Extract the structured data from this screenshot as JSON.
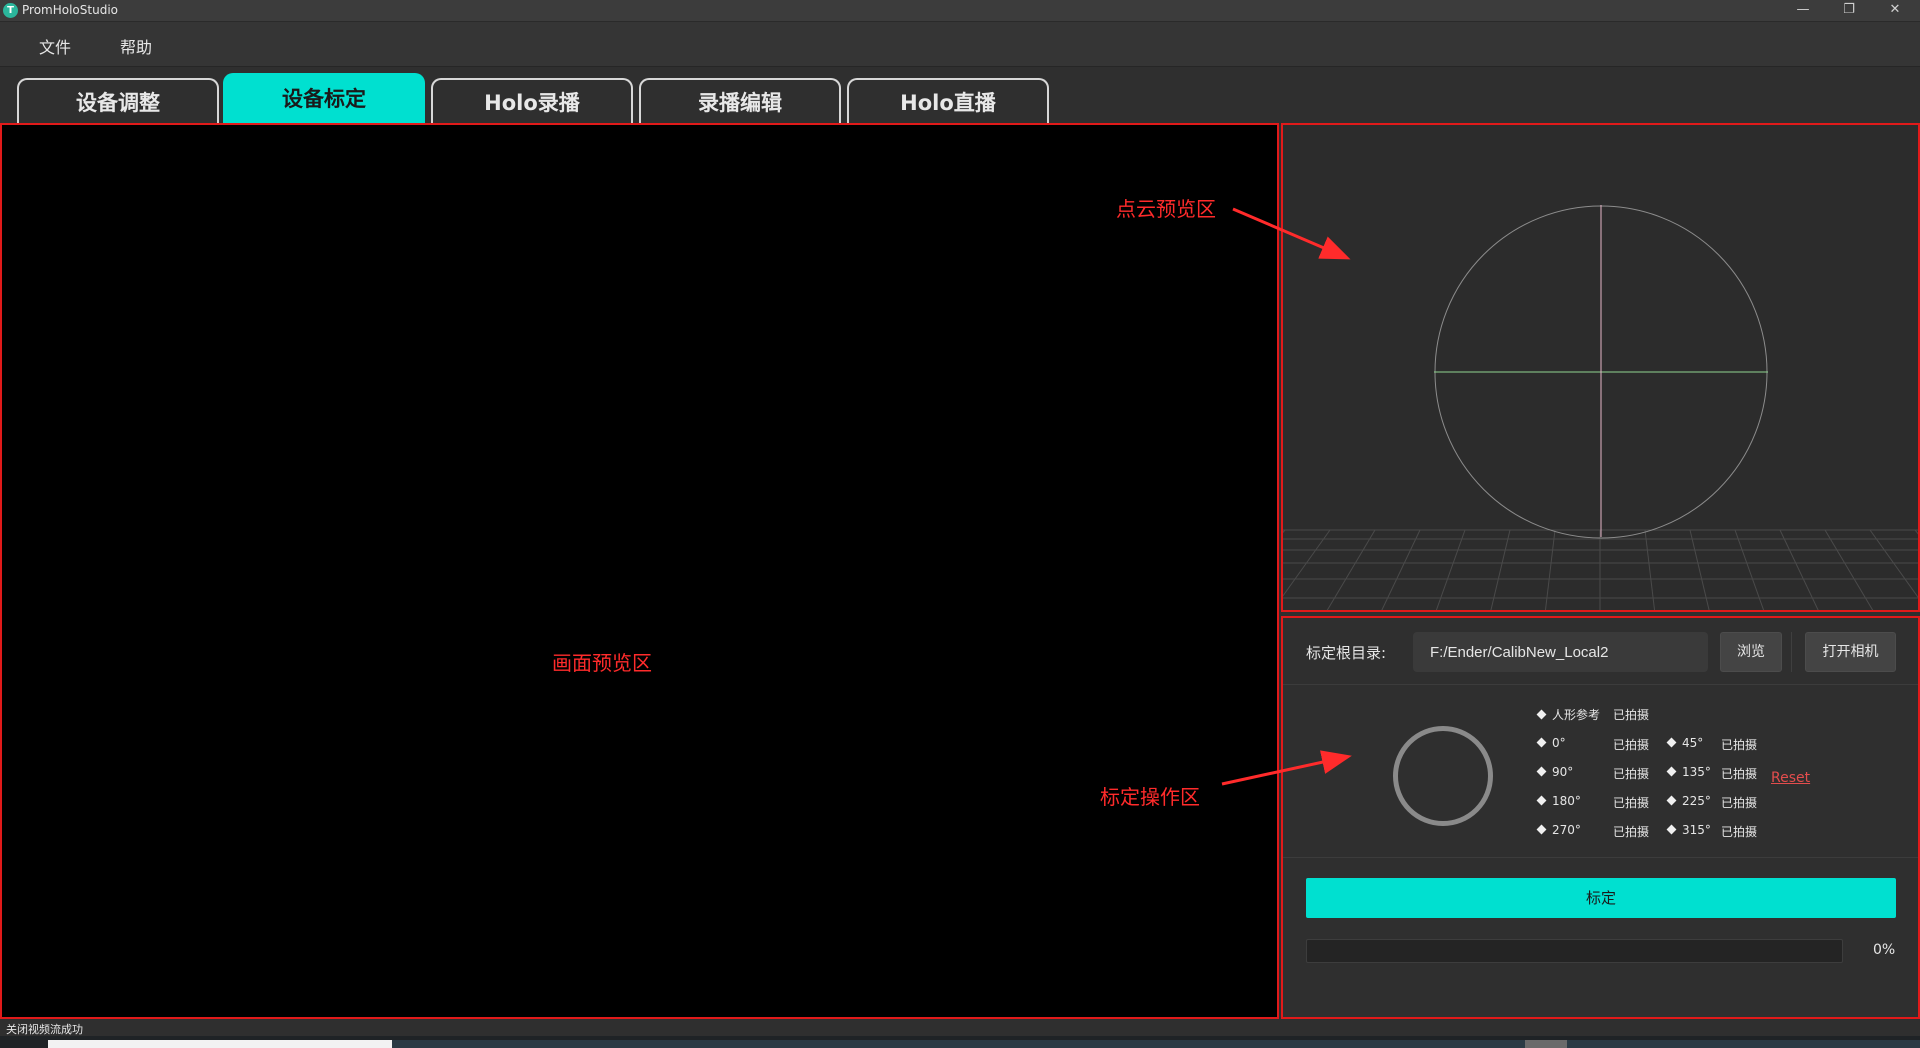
{
  "window": {
    "title": "PromHoloStudio",
    "logo_letter": "T",
    "minimize_glyph": "—",
    "maximize_glyph": "❐",
    "close_glyph": "✕"
  },
  "menu": {
    "items": [
      "文件",
      "帮助"
    ]
  },
  "tabs": [
    {
      "label": "设备调整",
      "active": false
    },
    {
      "label": "设备标定",
      "active": true
    },
    {
      "label": "Holo录播",
      "active": false
    },
    {
      "label": "录播编辑",
      "active": false
    },
    {
      "label": "Holo直播",
      "active": false
    }
  ],
  "annotations": {
    "video_preview": "画面预览区",
    "pointcloud_preview": "点云预览区",
    "calibration_ops": "标定操作区"
  },
  "calibration": {
    "root_label": "标定根目录:",
    "root_path": "F:/Ender/CalibNew_Local2",
    "browse_label": "浏览",
    "open_camera_label": "打开相机",
    "reset_label": "Reset",
    "captures": [
      {
        "name": "人形参考",
        "status": "已拍摄"
      },
      {
        "name": "0°",
        "status": "已拍摄"
      },
      {
        "name": "45°",
        "status": "已拍摄"
      },
      {
        "name": "90°",
        "status": "已拍摄"
      },
      {
        "name": "135°",
        "status": "已拍摄"
      },
      {
        "name": "180°",
        "status": "已拍摄"
      },
      {
        "name": "225°",
        "status": "已拍摄"
      },
      {
        "name": "270°",
        "status": "已拍摄"
      },
      {
        "name": "315°",
        "status": "已拍摄"
      }
    ],
    "calibrate_label": "标定",
    "progress_percent": 0,
    "progress_text": "0%"
  },
  "status": {
    "message": "关闭视频流成功"
  },
  "colors": {
    "accent": "#00e0d0",
    "annotation": "#ff2b2b",
    "reset": "#e34d4d"
  }
}
